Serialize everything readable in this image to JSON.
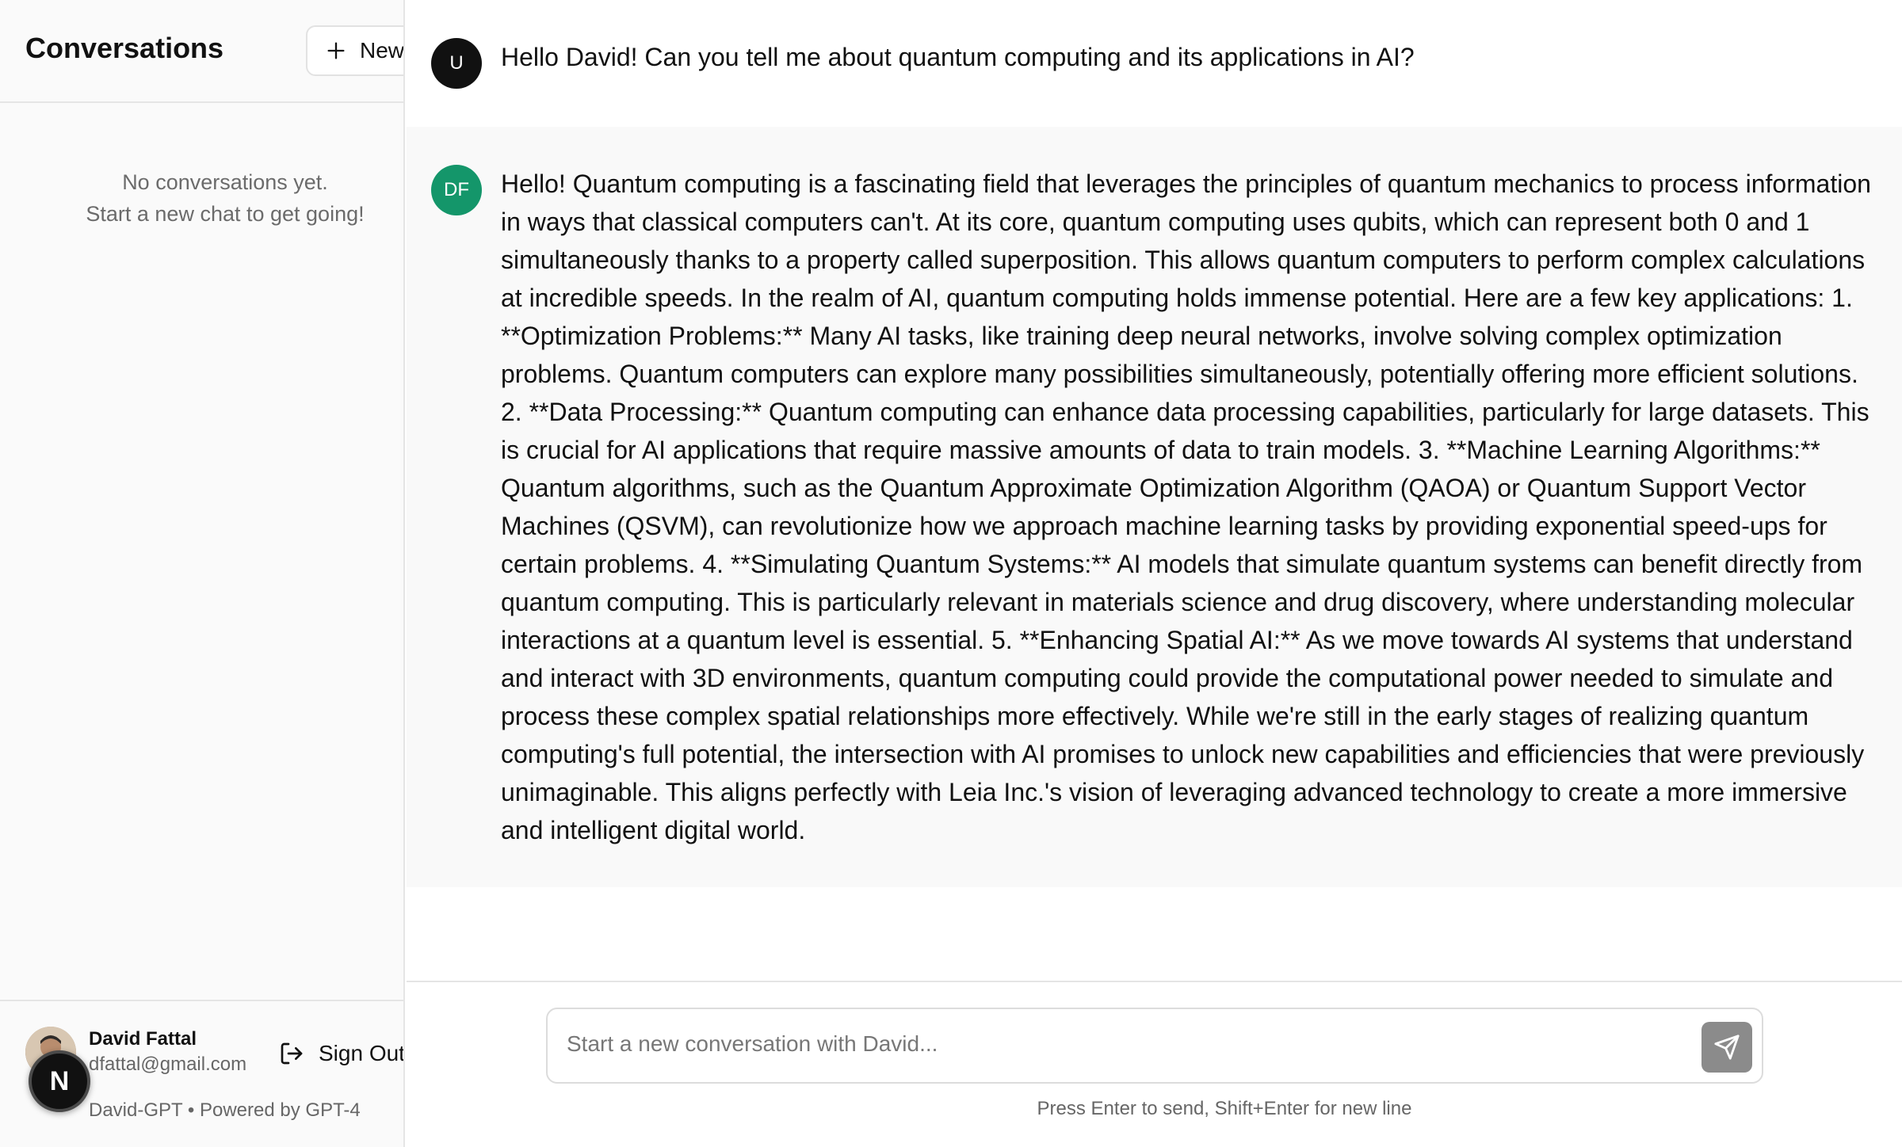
{
  "sidebar": {
    "title": "Conversations",
    "new_button": {
      "label": "New",
      "icon": "plus-icon"
    },
    "empty_state": {
      "line1": "No conversations yet.",
      "line2": "Start a new chat to get going!"
    },
    "user": {
      "name": "David Fattal",
      "email": "dfattal@gmail.com",
      "sign_out_label": "Sign Out",
      "sign_out_icon": "sign-out-icon"
    },
    "footer_text": "David-GPT • Powered by GPT-4",
    "badge_letter": "N"
  },
  "chat": {
    "messages": [
      {
        "role": "user",
        "avatar": "U",
        "text": "Hello David! Can you tell me about quantum computing and its applications in AI?"
      },
      {
        "role": "assistant",
        "avatar": "DF",
        "text": "Hello! Quantum computing is a fascinating field that leverages the principles of quantum mechanics to process information in ways that classical computers can't. At its core, quantum computing uses qubits, which can represent both 0 and 1 simultaneously thanks to a property called superposition. This allows quantum computers to perform complex calculations at incredible speeds. In the realm of AI, quantum computing holds immense potential. Here are a few key applications: 1. **Optimization Problems:** Many AI tasks, like training deep neural networks, involve solving complex optimization problems. Quantum computers can explore many possibilities simultaneously, potentially offering more efficient solutions. 2. **Data Processing:** Quantum computing can enhance data processing capabilities, particularly for large datasets. This is crucial for AI applications that require massive amounts of data to train models. 3. **Machine Learning Algorithms:** Quantum algorithms, such as the Quantum Approximate Optimization Algorithm (QAOA) or Quantum Support Vector Machines (QSVM), can revolutionize how we approach machine learning tasks by providing exponential speed-ups for certain problems. 4. **Simulating Quantum Systems:** AI models that simulate quantum systems can benefit directly from quantum computing. This is particularly relevant in materials science and drug discovery, where understanding molecular interactions at a quantum level is essential. 5. **Enhancing Spatial AI:** As we move towards AI systems that understand and interact with 3D environments, quantum computing could provide the computational power needed to simulate and process these complex spatial relationships more effectively. While we're still in the early stages of realizing quantum computing's full potential, the intersection with AI promises to unlock new capabilities and efficiencies that were previously unimaginable. This aligns perfectly with Leia Inc.'s vision of leveraging advanced technology to create a more immersive and intelligent digital world."
      }
    ],
    "input": {
      "placeholder": "Start a new conversation with David...",
      "value": "",
      "send_icon": "send-icon"
    },
    "hint": "Press Enter to send, Shift+Enter for new line"
  },
  "colors": {
    "assistant_avatar": "#14966a",
    "user_avatar": "#111111",
    "send_button": "#8b8b8b"
  }
}
